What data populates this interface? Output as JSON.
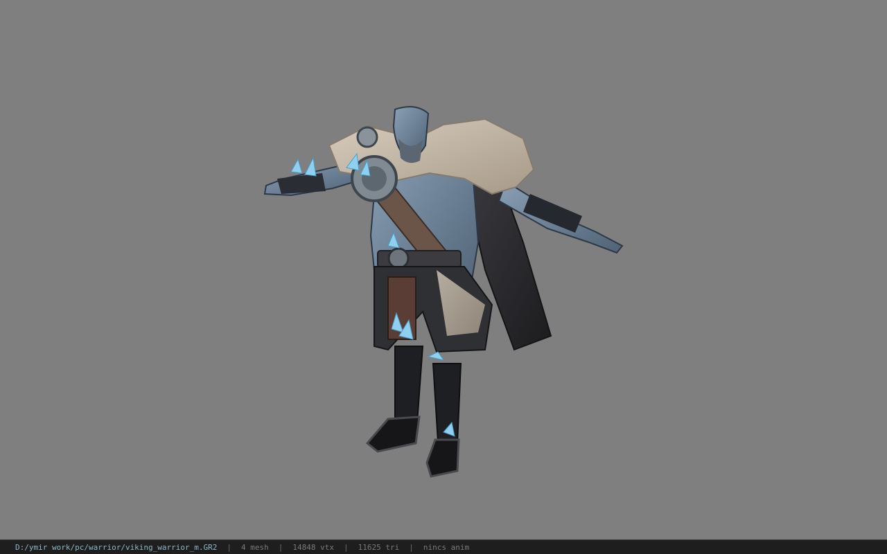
{
  "viewer": {
    "background_color": "#7f7f7f",
    "model_icon": "3d-character-model"
  },
  "status_bar": {
    "file_path": "D:/ymir work/pc/warrior/viking_warrior_m.GR2",
    "separator": "|",
    "mesh_count": "4 mesh",
    "vertex_count": "14848 vtx",
    "triangle_count": "11625 tri",
    "animation": "nincs anim"
  }
}
